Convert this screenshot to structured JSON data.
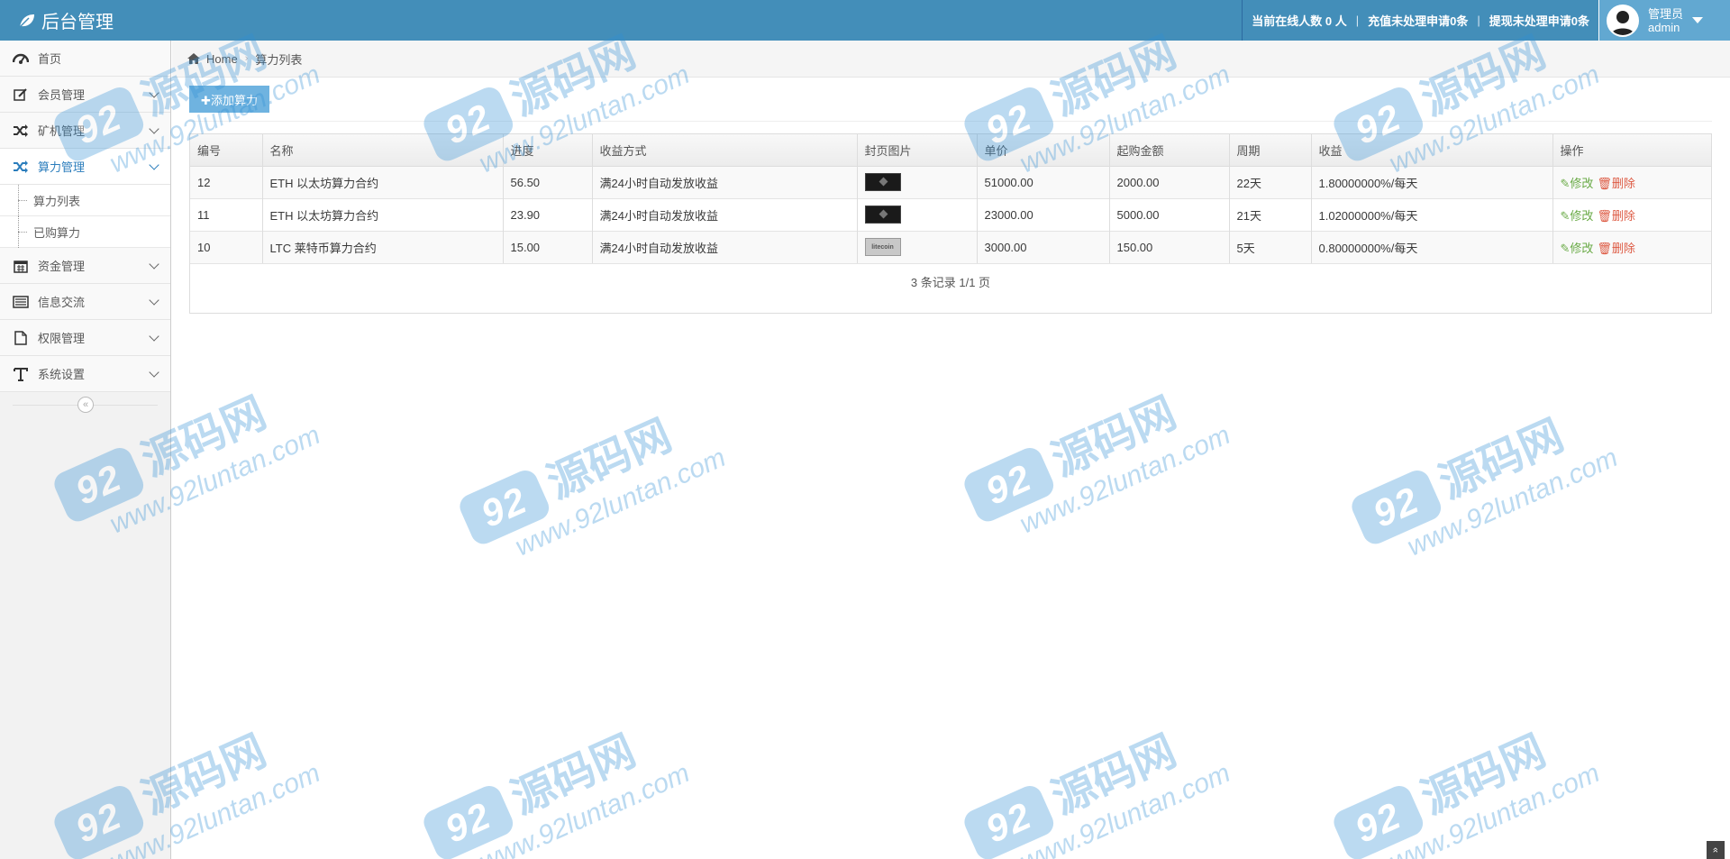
{
  "navbar": {
    "brand": "后台管理",
    "online_label": "当前在线人数",
    "online_count": "0",
    "online_unit": "人",
    "recharge_pending": "充值未处理申请0条",
    "withdraw_pending": "提现未处理申请0条",
    "user_role": "管理员",
    "user_name": "admin"
  },
  "sidebar": {
    "items": [
      {
        "label": "首页",
        "icon": "dashboard-icon"
      },
      {
        "label": "会员管理",
        "icon": "edit-icon"
      },
      {
        "label": "矿机管理",
        "icon": "shuffle-icon"
      },
      {
        "label": "算力管理",
        "icon": "shuffle-icon"
      },
      {
        "label": "资金管理",
        "icon": "calendar-icon"
      },
      {
        "label": "信息交流",
        "icon": "list-icon"
      },
      {
        "label": "权限管理",
        "icon": "file-icon"
      },
      {
        "label": "系统设置",
        "icon": "text-icon"
      }
    ],
    "sub_items": [
      {
        "label": "算力列表"
      },
      {
        "label": "已购算力"
      }
    ],
    "collapse_glyph": "«"
  },
  "breadcrumb": {
    "home": "Home",
    "sep": "›",
    "current": "算力列表"
  },
  "toolbar": {
    "add_label": "✚添加算力"
  },
  "table": {
    "headers": [
      "编号",
      "名称",
      "进度",
      "收益方式",
      "封页图片",
      "单价",
      "起购金额",
      "周期",
      "收益",
      "操作"
    ],
    "rows": [
      {
        "id": "12",
        "name": "ETH 以太坊算力合约",
        "progress": "56.50",
        "mode": "满24小时自动发放收益",
        "cover": "dark",
        "price": "51000.00",
        "min": "2000.00",
        "period": "22天",
        "income": "1.80000000%/每天"
      },
      {
        "id": "11",
        "name": "ETH 以太坊算力合约",
        "progress": "23.90",
        "mode": "满24小时自动发放收益",
        "cover": "dark",
        "price": "23000.00",
        "min": "5000.00",
        "period": "21天",
        "income": "1.02000000%/每天"
      },
      {
        "id": "10",
        "name": "LTC 莱特币算力合约",
        "progress": "15.00",
        "mode": "满24小时自动发放收益",
        "cover": "light",
        "price": "3000.00",
        "min": "150.00",
        "period": "5天",
        "income": "0.80000000%/每天"
      }
    ],
    "edit_label": "✎修改",
    "delete_label": "🗑删除",
    "cover_light_text": "litecoin"
  },
  "pager": {
    "text": "3 条记录 1/1 页"
  },
  "watermark": {
    "badge": "92",
    "cn": "源码网",
    "url": "www.92luntan.com"
  },
  "scroll_top_glyph": "»",
  "colors": {
    "navbar": "#438eb9",
    "user_box": "#62a8d1",
    "add_button": "#6fb3e0",
    "edit": "#69aa46",
    "delete": "#dd5a43",
    "active_nav": "#2b7dbc"
  }
}
